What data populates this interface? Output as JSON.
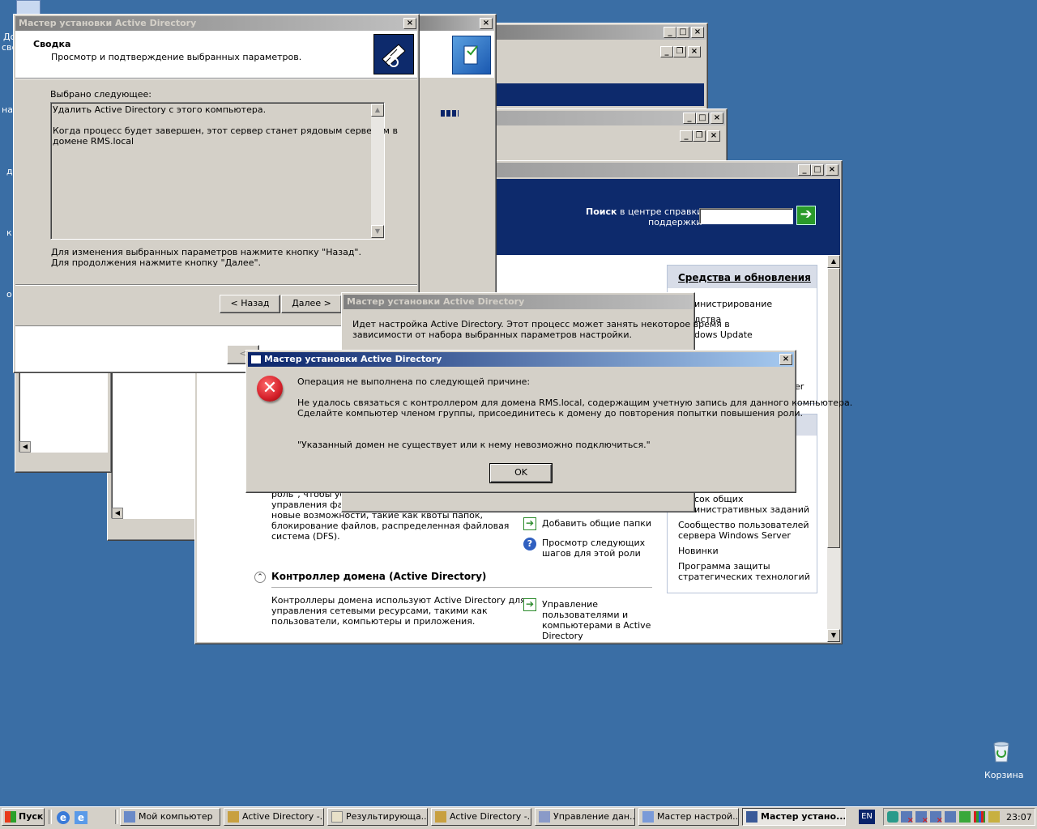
{
  "desktop": {
    "recycle_bin_label": "Корзина",
    "left_fragments": [
      "До",
      "све",
      "на",
      "д",
      "к",
      "о"
    ]
  },
  "win_a": {
    "buttons": [
      "_",
      "□",
      "×"
    ],
    "inner_buttons": [
      "_",
      "❐",
      "×"
    ]
  },
  "win_b": {
    "buttons": [
      "_",
      "□",
      "×"
    ],
    "inner_buttons": [
      "_",
      "❐",
      "×"
    ]
  },
  "manage_server": {
    "buttons": [
      "_",
      "□",
      "×"
    ],
    "search_label_bold": "Поиск",
    "search_label_rest": " в центре справки и",
    "search_label_line2": "поддержки",
    "search_value": "",
    "tools_panel": {
      "title": "Средства и обновления",
      "items": [
        "инистрирование",
        "дства",
        "dows Update"
      ]
    },
    "right_links": [
      "сок общих",
      "инистративных заданий",
      "Сообщество пользователей",
      "сервера Windows Server",
      "Новинки",
      "Программа защиты",
      "стратегических технологий"
    ],
    "file_role_text": [
      "роль\", чтобы уст",
      "управления фай",
      "новые возможности, такие как квоты папок,",
      "блокирование файлов, распределенная файловая",
      "система (DFS)."
    ],
    "actions": [
      "Добавить общие папки",
      "Просмотр следующих",
      "шагов для этой роли"
    ],
    "dc_section": {
      "title": "Контроллер домена (Active Directory)",
      "desc": [
        "Контроллеры домена используют Active Directory для",
        "управления сетевыми ресурсами, такими как",
        "пользователи, компьютеры и приложения."
      ],
      "action": [
        "Управление",
        "пользователями и",
        "компьютерами в Active",
        "Directory"
      ]
    },
    "fragment_ter": "er"
  },
  "wizard_main": {
    "title": "Мастер установки Active Directory",
    "header_title": "Сводка",
    "header_subtitle": "Просмотр и подтверждение выбранных параметров.",
    "selected_label": "Выбрано следующее:",
    "summary_lines": [
      "Удалить Active Directory с этого компьютера.",
      "",
      "Когда процесс будет завершен, этот сервер станет рядовым сервером в",
      "домене RMS.local"
    ],
    "hint_line1": "Для изменения выбранных параметров нажмите кнопку \"Назад\".",
    "hint_line2": "Для продолжения нажмите кнопку \"Далее\".",
    "back_button": "< Назад",
    "next_button": "Далее >",
    "close": "×"
  },
  "wizard_progress": {
    "title": "Мастер установки Active Directory",
    "text_line1": "Идет настройка Active Directory.  Этот процесс может занять некоторое время в",
    "text_line2": "зависимости от набора выбранных параметров настройки."
  },
  "error_dialog": {
    "title": "Мастер установки Active Directory",
    "line1": "Операция не выполнена по следующей причине:",
    "line2": "Не удалось связаться с контроллером для домена RMS.local, содержащим учетную запись для данного компьютера.",
    "line3": "Сделайте компьютер членом группы, присоединитесь к домену до повторения попытки повышения роли.",
    "line4": "\"Указанный домен не существует или к нему невозможно подключиться.\"",
    "ok": "OK",
    "close": "×"
  },
  "taskbar": {
    "start": "Пуск",
    "items": [
      {
        "label": "Мой компьютер",
        "pressed": false
      },
      {
        "label": "Active Directory -...",
        "pressed": false
      },
      {
        "label": "Результирующа...",
        "pressed": false
      },
      {
        "label": "Active Directory -...",
        "pressed": false
      },
      {
        "label": "Управление дан...",
        "pressed": false
      },
      {
        "label": "Мастер настрой...",
        "pressed": false
      },
      {
        "label": "Мастер устано...",
        "pressed": true
      }
    ],
    "lang": "EN",
    "clock": "23:07"
  },
  "colors": {
    "desktop": "#3a6ea5",
    "active_title": "#0a246a",
    "error_red": "#d4202a",
    "banner": "#0d2a6c"
  }
}
